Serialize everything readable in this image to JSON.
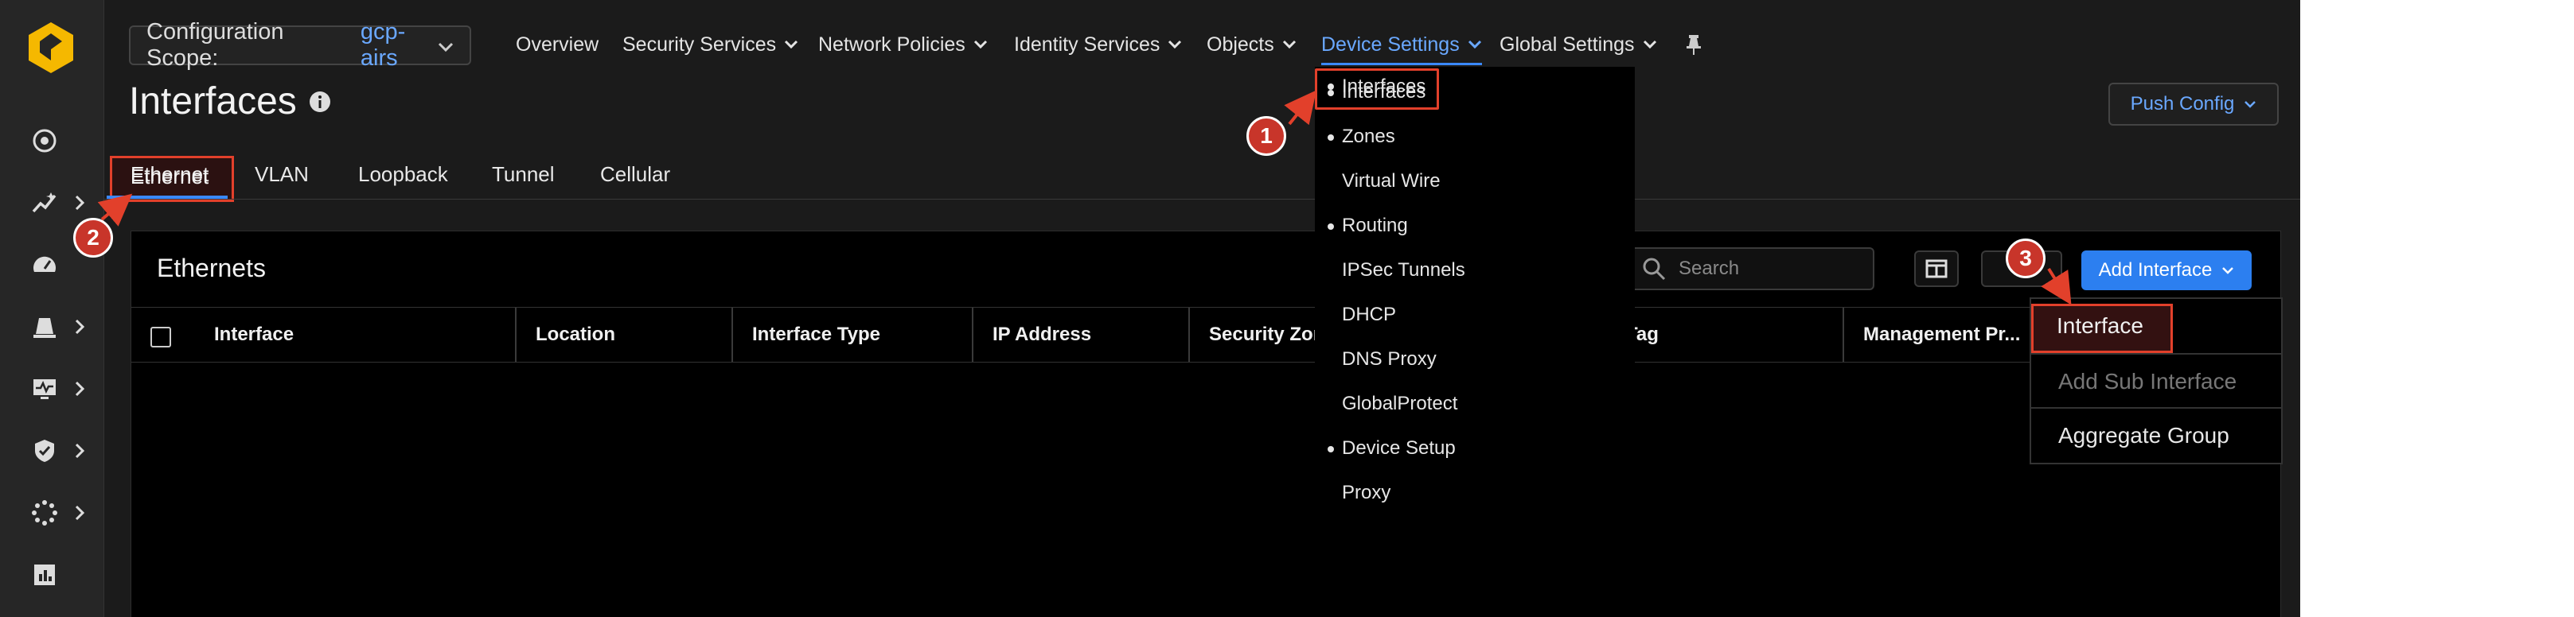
{
  "top_nav": {
    "scope_label": "Configuration Scope:",
    "scope_value": "gcp-airs",
    "items": [
      {
        "label": "Overview"
      },
      {
        "label": "Security Services"
      },
      {
        "label": "Network Policies"
      },
      {
        "label": "Identity Services"
      },
      {
        "label": "Objects"
      },
      {
        "label": "Device Settings"
      },
      {
        "label": "Global Settings"
      }
    ],
    "active_item": "Device Settings",
    "pin_icon": "pin-icon"
  },
  "page": {
    "title": "Interfaces",
    "push_config_label": "Push Config"
  },
  "tabs": [
    {
      "label": "Ethernet"
    },
    {
      "label": "VLAN"
    },
    {
      "label": "Loopback"
    },
    {
      "label": "Tunnel"
    },
    {
      "label": "Cellular"
    }
  ],
  "active_tab": "Ethernet",
  "table": {
    "title": "Ethernets",
    "search_placeholder": "Search",
    "add_button_label": "Add Interface",
    "columns": [
      "Interface",
      "Location",
      "Interface Type",
      "IP Address",
      "Security Zone",
      "Tag",
      "Management Pr..."
    ]
  },
  "device_settings_menu": {
    "items": [
      {
        "label": "Interfaces",
        "dot": true
      },
      {
        "label": "Zones",
        "dot": true
      },
      {
        "label": "Virtual Wire",
        "dot": false
      },
      {
        "label": "Routing",
        "dot": true
      },
      {
        "label": "IPSec Tunnels",
        "dot": false
      },
      {
        "label": "DHCP",
        "dot": false
      },
      {
        "label": "DNS Proxy",
        "dot": false
      },
      {
        "label": "GlobalProtect",
        "dot": false
      },
      {
        "label": "Device Setup",
        "dot": true
      },
      {
        "label": "Proxy",
        "dot": false
      }
    ]
  },
  "add_interface_menu": {
    "items": [
      {
        "label": "Interface",
        "disabled": false
      },
      {
        "label": "Add Sub Interface",
        "disabled": true
      },
      {
        "label": "Aggregate Group",
        "disabled": false
      }
    ]
  },
  "annotations": {
    "step1": "1",
    "step2": "2",
    "step3": "3",
    "highlight_color": "#e2402b"
  },
  "colors": {
    "accent": "#3a88ff",
    "link": "#6aa8ff",
    "primary_button": "#2c7ff0",
    "logo": "#f5b800"
  },
  "sidebar_icons": [
    "dashboard-icon",
    "insights-icon",
    "speedometer-icon",
    "alert-bell-icon",
    "monitor-icon",
    "shield-check-icon",
    "settings-dots-icon",
    "report-icon"
  ]
}
